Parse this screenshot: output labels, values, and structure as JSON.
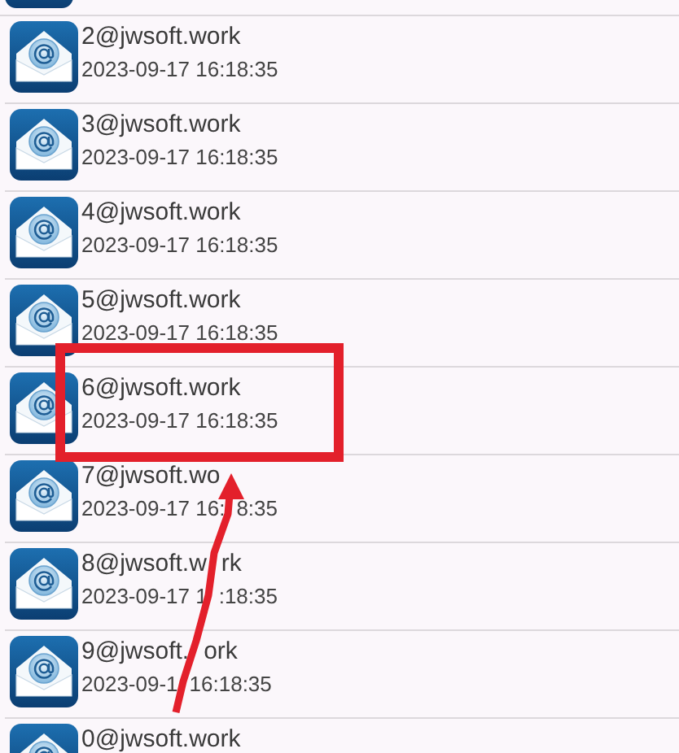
{
  "emails": [
    {
      "address": "2@jwsoft.work",
      "date": "2023-09-17 16:18:35"
    },
    {
      "address": "3@jwsoft.work",
      "date": "2023-09-17 16:18:35"
    },
    {
      "address": "4@jwsoft.work",
      "date": "2023-09-17 16:18:35"
    },
    {
      "address": "5@jwsoft.work",
      "date": "2023-09-17 16:18:35"
    },
    {
      "address": "6@jwsoft.work",
      "date": "2023-09-17 16:18:35"
    },
    {
      "address": "7@jwsoft.wo",
      "date": [
        "2023-09-17 16:",
        "8:35"
      ]
    },
    {
      "address": [
        "8@jwsoft.w",
        "rk"
      ],
      "date": [
        "2023-09-17 1",
        ":18:35"
      ]
    },
    {
      "address": [
        "9@jwsoft.",
        "ork"
      ],
      "date": [
        "2023-09-1",
        "16:18:35"
      ]
    },
    {
      "address": "0@jwsoft.work"
    }
  ]
}
